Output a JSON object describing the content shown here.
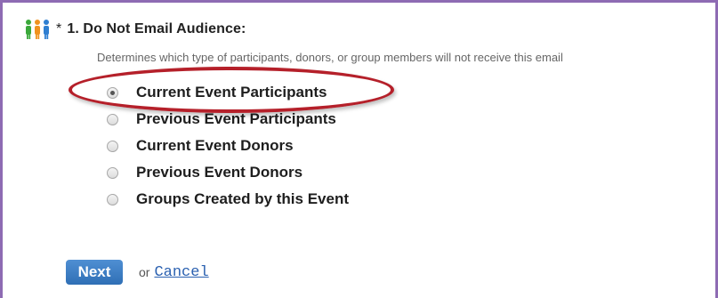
{
  "question": {
    "required_marker": "*",
    "title": "1.  Do Not Email Audience:",
    "description": "Determines which type of participants, donors, or group members will not receive this email",
    "icon": "people-group-icon"
  },
  "options": [
    {
      "label": "Current Event Participants",
      "checked": true
    },
    {
      "label": "Previous Event Participants",
      "checked": false
    },
    {
      "label": "Current Event Donors",
      "checked": false
    },
    {
      "label": "Previous Event Donors",
      "checked": false
    },
    {
      "label": "Groups Created by this Event",
      "checked": false
    }
  ],
  "actions": {
    "next_label": "Next",
    "or_text": "or",
    "cancel_label": "Cancel"
  },
  "colors": {
    "frame_border": "#8e6bb3",
    "highlight_ring": "#b5202a",
    "button_blue": "#2f6fb5",
    "link_blue": "#2a60b0"
  }
}
